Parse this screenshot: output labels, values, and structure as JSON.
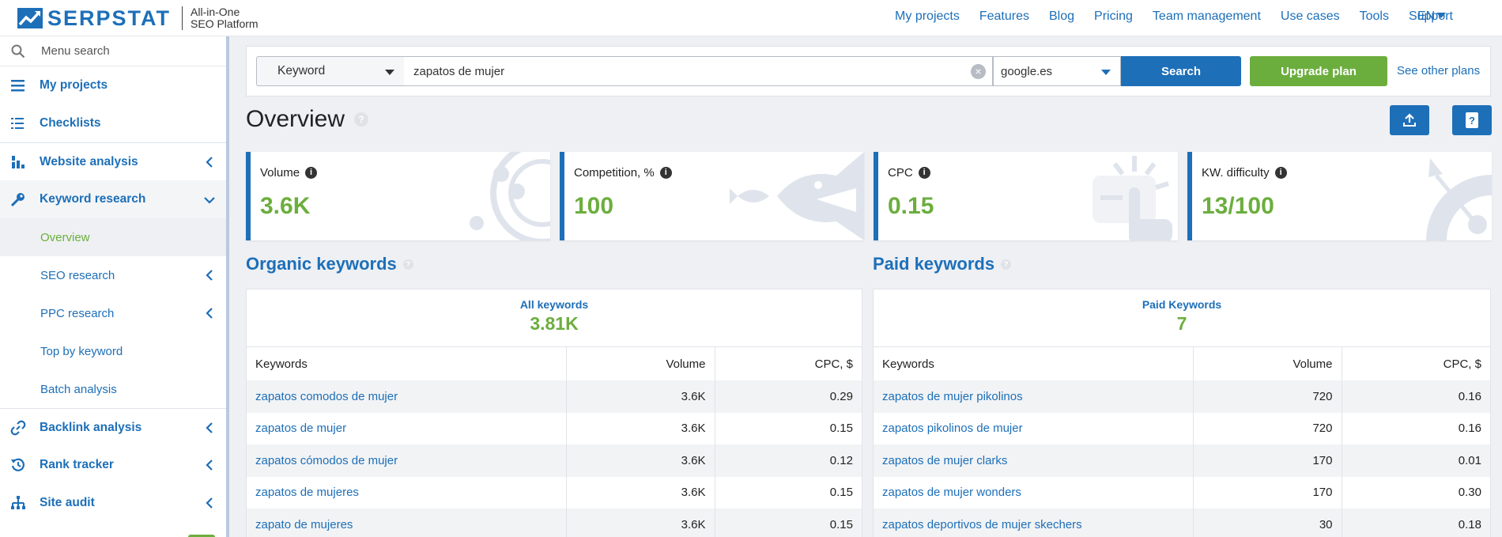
{
  "brand": {
    "name": "SERPSTAT",
    "tagline_line1": "All-in-One",
    "tagline_line2": "SEO Platform"
  },
  "topnav": {
    "items": [
      "My projects",
      "Features",
      "Blog",
      "Pricing",
      "Team management",
      "Use cases",
      "Tools",
      "Support"
    ],
    "lang": "EN"
  },
  "sidebar": {
    "search_placeholder": "Menu search",
    "items": [
      {
        "label": "My projects"
      },
      {
        "label": "Checklists"
      },
      {
        "label": "Website analysis"
      },
      {
        "label": "Keyword research"
      },
      {
        "label": "Overview"
      },
      {
        "label": "SEO research"
      },
      {
        "label": "PPC research"
      },
      {
        "label": "Top by keyword"
      },
      {
        "label": "Batch analysis"
      },
      {
        "label": "Backlink analysis"
      },
      {
        "label": "Rank tracker"
      },
      {
        "label": "Site audit"
      }
    ]
  },
  "search": {
    "type": "Keyword",
    "query": "zapatos de mujer",
    "database": "google.es",
    "search_label": "Search",
    "upgrade_label": "Upgrade plan",
    "other_plans": "See other plans"
  },
  "page": {
    "title": "Overview"
  },
  "cards": [
    {
      "label": "Volume",
      "value": "3.6K"
    },
    {
      "label": "Competition, %",
      "value": "100"
    },
    {
      "label": "CPC",
      "value": "0.15"
    },
    {
      "label": "KW. difficulty",
      "value": "13/100"
    }
  ],
  "organic": {
    "title": "Organic keywords",
    "summary_label": "All keywords",
    "summary_value": "3.81K",
    "columns": [
      "Keywords",
      "Volume",
      "CPC, $"
    ],
    "rows": [
      [
        "zapatos comodos de mujer",
        "3.6K",
        "0.29"
      ],
      [
        "zapatos de mujer",
        "3.6K",
        "0.15"
      ],
      [
        "zapatos cómodos de mujer",
        "3.6K",
        "0.12"
      ],
      [
        "zapatos de mujeres",
        "3.6K",
        "0.15"
      ],
      [
        "zapato de mujeres",
        "3.6K",
        "0.15"
      ]
    ]
  },
  "paid": {
    "title": "Paid keywords",
    "summary_label": "Paid Keywords",
    "summary_value": "7",
    "columns": [
      "Keywords",
      "Volume",
      "CPC, $"
    ],
    "rows": [
      [
        "zapatos de mujer pikolinos",
        "720",
        "0.16"
      ],
      [
        "zapatos pikolinos de mujer",
        "720",
        "0.16"
      ],
      [
        "zapatos de mujer clarks",
        "170",
        "0.01"
      ],
      [
        "zapatos de mujer wonders",
        "170",
        "0.30"
      ],
      [
        "zapatos deportivos de mujer skechers",
        "30",
        "0.18"
      ]
    ]
  },
  "colors": {
    "brand_blue": "#1d6fb8",
    "accent_green": "#6cae3e"
  }
}
